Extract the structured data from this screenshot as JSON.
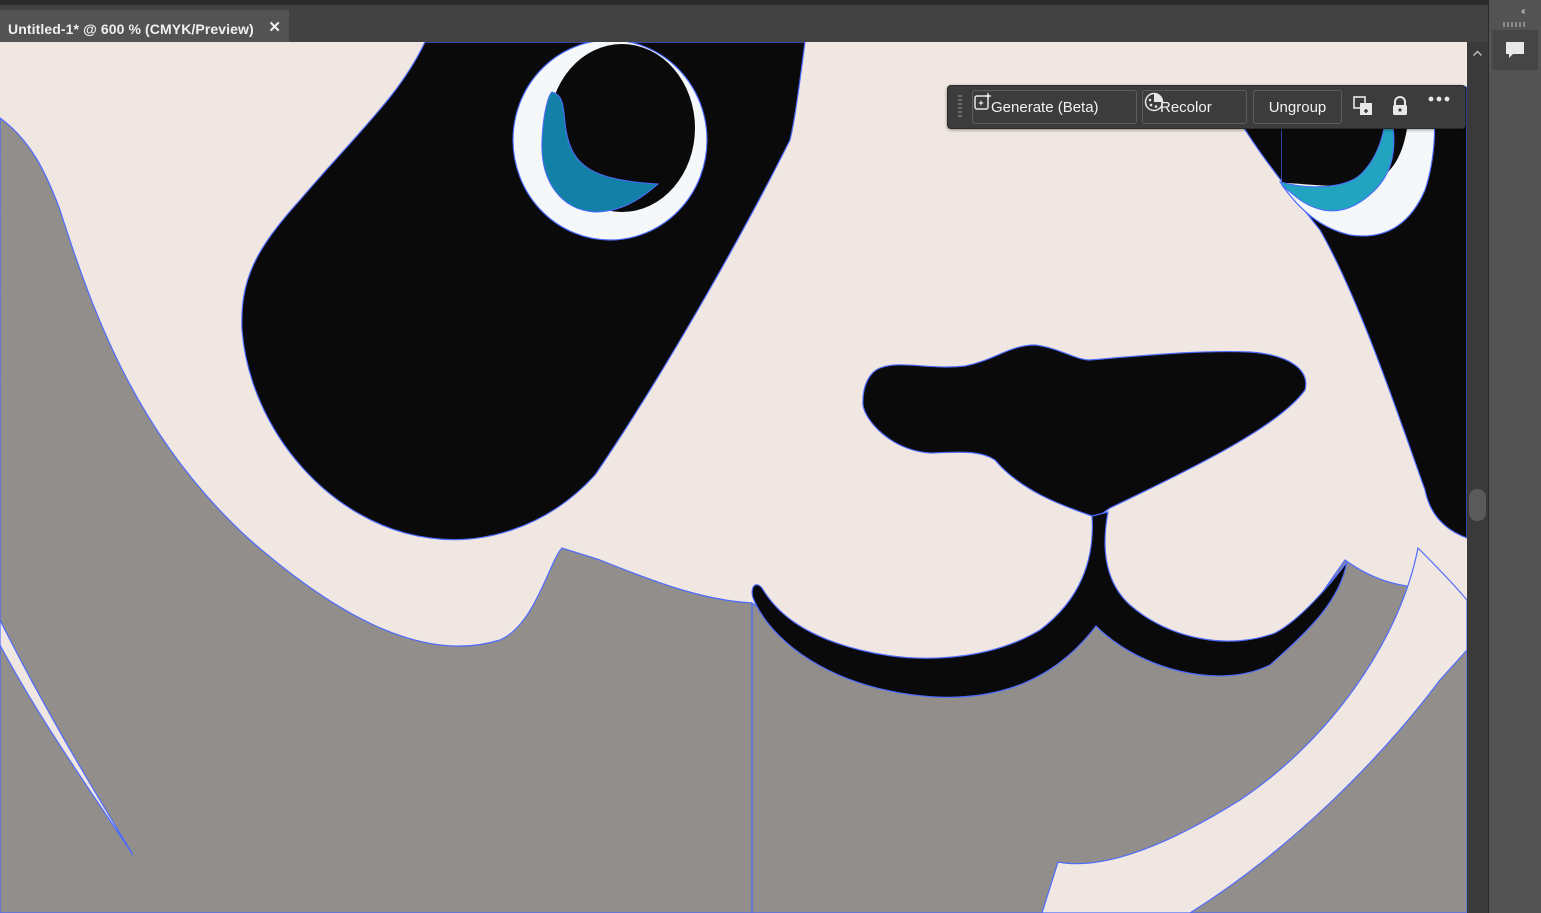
{
  "document_tab": {
    "title": "Untitled-1* @ 600 % (CMYK/Preview)",
    "close_glyph": "✕"
  },
  "contextual_taskbar": {
    "generate_label": "Generate (Beta)",
    "recolor_label": "Recolor",
    "ungroup_label": "Ungroup",
    "icons": [
      "generate-sparkle-icon",
      "recolor-icon",
      "arrange-icon",
      "lock-icon",
      "more-options-icon"
    ]
  },
  "right_panel": {
    "collapse_glyph": "‹‹",
    "icons": [
      "comments-icon"
    ]
  },
  "artwork": {
    "subject": "panda",
    "colors": {
      "background": "#f0e6e2",
      "fur_black": "#0a0a0a",
      "fur_gray": "#928e8b",
      "eye_white": "#f4f8fb",
      "eye_blue_left": "#1380a8",
      "eye_blue_right": "#22a3bf",
      "selection_outline": "#4e6bff"
    }
  }
}
